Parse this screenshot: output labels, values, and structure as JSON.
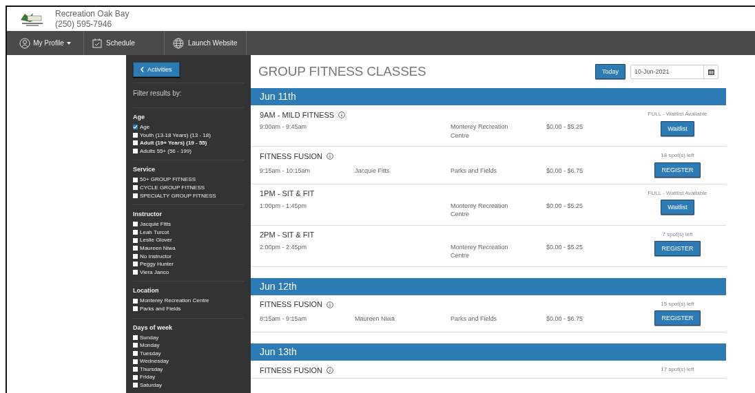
{
  "header": {
    "org_name": "Recreation Oak Bay",
    "phone": "(250) 595-7946"
  },
  "nav": [
    {
      "label": "My Profile"
    },
    {
      "label": "Schedule"
    },
    {
      "label": "Launch Website"
    }
  ],
  "sidebar": {
    "back_button": "Activities",
    "filter_title": "Filter results by:",
    "groups": [
      {
        "title": "Age",
        "options": [
          {
            "label": "Age",
            "checked": true,
            "bold": false
          },
          {
            "label": "Youth (13-18 Years) (13 - 18)",
            "checked": false,
            "bold": false
          },
          {
            "label": "Adult (19+ Years) (19 - 55)",
            "checked": false,
            "bold": true
          },
          {
            "label": "Adults 55+ (56 - 199)",
            "checked": false,
            "bold": false
          }
        ]
      },
      {
        "title": "Service",
        "options": [
          {
            "label": "50+ GROUP FITNESS",
            "checked": false,
            "bold": false
          },
          {
            "label": "CYCLE GROUP FITNESS",
            "checked": false,
            "bold": false
          },
          {
            "label": "SPECIALTY GROUP FITNESS",
            "checked": false,
            "bold": false
          }
        ]
      },
      {
        "title": "Instructor",
        "options": [
          {
            "label": "Jacquie Fitts",
            "checked": false,
            "bold": false
          },
          {
            "label": "Leah Turcot",
            "checked": false,
            "bold": false
          },
          {
            "label": "Leslie Glover",
            "checked": false,
            "bold": false
          },
          {
            "label": "Maureen Niwa",
            "checked": false,
            "bold": false
          },
          {
            "label": "No Instructor",
            "checked": false,
            "bold": false
          },
          {
            "label": "Peggy Hunter",
            "checked": false,
            "bold": false
          },
          {
            "label": "Viera Janco",
            "checked": false,
            "bold": false
          }
        ]
      },
      {
        "title": "Location",
        "options": [
          {
            "label": "Monterey Recreation Centre",
            "checked": false,
            "bold": false
          },
          {
            "label": "Parks and Fields",
            "checked": false,
            "bold": false
          }
        ]
      },
      {
        "title": "Days of week",
        "options": [
          {
            "label": "Sunday",
            "checked": false,
            "bold": false
          },
          {
            "label": "Monday",
            "checked": false,
            "bold": false
          },
          {
            "label": "Tuesday",
            "checked": false,
            "bold": false
          },
          {
            "label": "Wednesday",
            "checked": false,
            "bold": false
          },
          {
            "label": "Thursday",
            "checked": false,
            "bold": false
          },
          {
            "label": "Friday",
            "checked": false,
            "bold": false
          },
          {
            "label": "Saturday",
            "checked": false,
            "bold": false
          }
        ]
      }
    ]
  },
  "content": {
    "title": "GROUP FITNESS CLASSES",
    "today_button": "Today",
    "date_value": "10-Jun-2021",
    "days": [
      {
        "date": "Jun 11th",
        "classes": [
          {
            "name": "9AM - MILD FITNESS",
            "info": true,
            "time": "9:00am - 9:45am",
            "location": "Monterey Recreation Centre",
            "price": "$0.00 - $5.25",
            "status": "FULL - Waitlist Available",
            "action": "Waitlist"
          },
          {
            "name": "FITNESS FUSION",
            "info": true,
            "time": "9:15am - 10:15am",
            "instructor": "Jacquie Fitts",
            "location": "Parks and Fields",
            "price": "$0.00 - $6.75",
            "status": "18 spot(s) left",
            "action": "REGISTER"
          },
          {
            "name": "1PM - SIT & FIT",
            "info": false,
            "time": "1:00pm - 1:45pm",
            "location": "Monterey Recreation Centre",
            "price": "$0.00 - $5.25",
            "status": "FULL - Waitlist Available",
            "action": "Waitlist"
          },
          {
            "name": "2PM - SIT & FIT",
            "info": false,
            "time": "2:00pm - 2:45pm",
            "location": "Monterey Recreation Centre",
            "price": "$0.00 - $5.25",
            "status": "7 spot(s) left",
            "action": "REGISTER"
          }
        ]
      },
      {
        "date": "Jun 12th",
        "classes": [
          {
            "name": "FITNESS FUSION",
            "info": true,
            "time": "8:15am - 9:15am",
            "instructor": "Maureen Niwa",
            "location": "Parks and Fields",
            "price": "$0.00 - $6.75",
            "status": "15 spot(s) left",
            "action": "REGISTER"
          }
        ]
      },
      {
        "date": "Jun 13th",
        "classes": [
          {
            "name": "FITNESS FUSION",
            "info": true,
            "status": "17 spot(s) left"
          }
        ]
      }
    ]
  }
}
